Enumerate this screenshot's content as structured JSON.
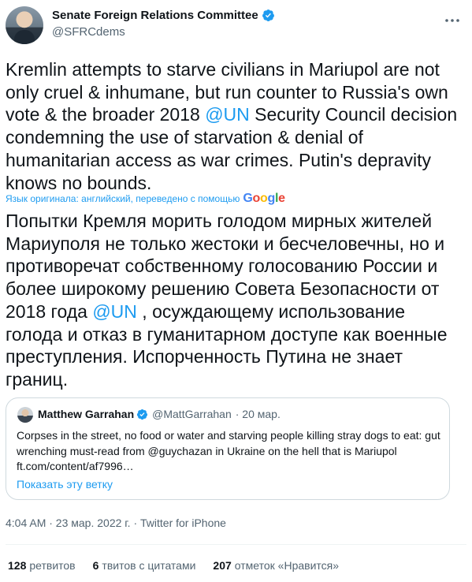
{
  "author": {
    "display_name": "Senate Foreign Relations Committee",
    "handle": "@SFRCdems"
  },
  "tweet": {
    "text_before": "Kremlin attempts to starve civilians in Mariupol are not only cruel & inhumane, but run counter to Russia's own vote & the broader 2018 ",
    "mention": "@UN",
    "text_after": " Security Council decision condemning the use of starvation & denial of humanitarian access as war crimes. Putin's depravity knows no bounds."
  },
  "translation_notice": {
    "label": "Язык оригинала: английский, переведено с помощью",
    "provider": "Google"
  },
  "translation": {
    "text_before": "Попытки Кремля морить голодом мирных жителей Мариуполя не только жестоки и бесчеловечны, но и противоречат собственному голосованию России и более широкому решению Совета Безопасности от 2018 года ",
    "mention": "@UN",
    "text_after": " , осуждающему использование голода и отказ в гуманитарном доступе как военные преступления. Испорченность Путина не знает границ."
  },
  "quote": {
    "display_name": "Matthew Garrahan",
    "handle": "@MattGarrahan",
    "date": "· 20 мар.",
    "text": "Corpses in the street, no food or water and starving people killing stray dogs to eat: gut wrenching must-read from @guychazan in Ukraine on the hell that is Mariupol ft.com/content/af7996…",
    "show_thread": "Показать эту ветку"
  },
  "timestamp": "4:04 AM · 23 мар. 2022 г. · Twitter for iPhone",
  "stats": {
    "retweets_count": "128",
    "retweets_label": "ретвитов",
    "quotes_count": "6",
    "quotes_label": "твитов с цитатами",
    "likes_count": "207",
    "likes_label": "отметок «Нравится»"
  },
  "colors": {
    "accent": "#1d9bf0",
    "text": "#0f1419",
    "secondary": "#536471",
    "border": "#cfd9de"
  },
  "icons": {
    "verified": "verified-badge-icon",
    "more": "more-dots-icon"
  }
}
